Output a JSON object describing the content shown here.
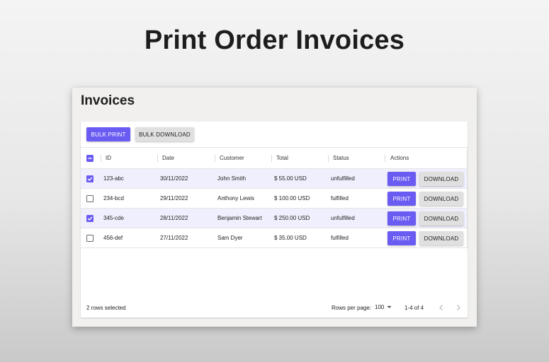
{
  "page": {
    "title": "Print Order Invoices"
  },
  "window": {
    "title": "Invoices"
  },
  "toolbar": {
    "bulk_print_label": "BULK PRINT",
    "bulk_download_label": "BULK DOWNLOAD"
  },
  "table": {
    "columns": [
      "ID",
      "Date",
      "Customer",
      "Total",
      "Status",
      "Actions"
    ],
    "header_checkbox": "indeterminate",
    "rows": [
      {
        "id": "123-abc",
        "date": "30/11/2022",
        "customer": "John Smith",
        "total": "$ 55.00 USD",
        "status": "unfulfilled",
        "selected": true,
        "print_label": "PRINT",
        "download_label": "DOWNLOAD"
      },
      {
        "id": "234-bcd",
        "date": "29/11/2022",
        "customer": "Anthony Lewis",
        "total": "$ 100.00 USD",
        "status": "fulfilled",
        "selected": false,
        "print_label": "PRINT",
        "download_label": "DOWNLOAD"
      },
      {
        "id": "345-cde",
        "date": "28/11/2022",
        "customer": "Benjamin Stewart",
        "total": "$ 250.00 USD",
        "status": "unfulfilled",
        "selected": true,
        "print_label": "PRINT",
        "download_label": "DOWNLOAD"
      },
      {
        "id": "456-def",
        "date": "27/11/2022",
        "customer": "Sam Dyer",
        "total": "$ 35.00 USD",
        "status": "fulfilled",
        "selected": false,
        "print_label": "PRINT",
        "download_label": "DOWNLOAD"
      }
    ]
  },
  "footer": {
    "selected_text": "2 rows selected",
    "rows_per_page_label": "Rows per page:",
    "rows_per_page_value": "100",
    "range_text": "1-4 of 4"
  },
  "colors": {
    "accent": "#6a5bf2",
    "selected_row": "#f0effd",
    "secondary_button": "#e0e0e0"
  },
  "icons": {
    "check": "check-icon",
    "indeterminate": "minus-icon",
    "dropdown": "caret-down-icon",
    "prev": "chevron-left-icon",
    "next": "chevron-right-icon"
  }
}
